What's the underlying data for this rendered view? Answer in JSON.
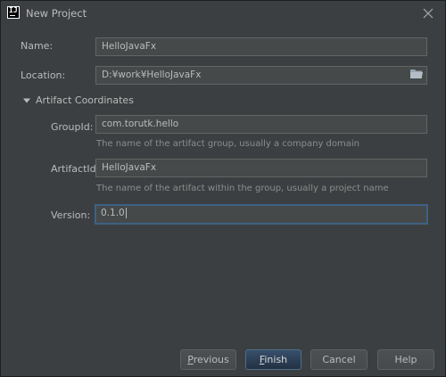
{
  "window": {
    "title": "New Project",
    "app_icon": "intellij-idea-icon",
    "close_icon": "close-icon"
  },
  "form": {
    "name": {
      "label": "Name:",
      "value": "HelloJavaFx"
    },
    "location": {
      "label": "Location:",
      "value": "D:¥work¥HelloJavaFx",
      "browse_icon": "folder-icon"
    },
    "artifact_section": {
      "title": "Artifact Coordinates",
      "expanded": true,
      "toggle_icon": "triangle-down-icon"
    },
    "group_id": {
      "label": "GroupId:",
      "value": "com.torutk.hello",
      "hint": "The name of the artifact group, usually a company domain"
    },
    "artifact_id": {
      "label": "ArtifactId:",
      "value": "HelloJavaFx",
      "hint": "The name of the artifact within the group, usually a project name"
    },
    "version": {
      "label": "Version:",
      "value": "0.1.0",
      "focused": true
    }
  },
  "buttons": {
    "previous": {
      "label_mnemonic": "P",
      "label_rest": "revious"
    },
    "finish": {
      "label_mnemonic": "F",
      "label_rest": "inish",
      "default": true
    },
    "cancel": {
      "label": "Cancel"
    },
    "help": {
      "label": "Help"
    }
  },
  "colors": {
    "background": "#3c3f41",
    "field_background": "#45494a",
    "focus_border": "#3d6185",
    "default_button": "#365880",
    "text": "#bbbbbb",
    "hint_text": "#8c8c8c"
  }
}
